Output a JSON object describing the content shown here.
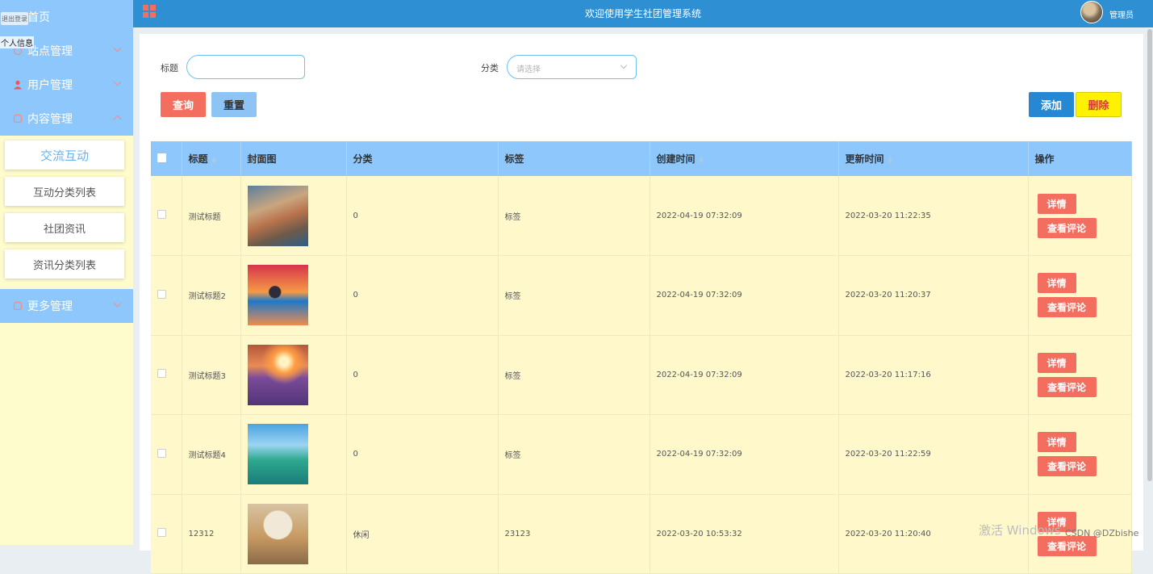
{
  "header": {
    "title": "欢迎使用学生社团管理系统",
    "user": "管理员",
    "colors": {
      "bar": "#2e8fd3",
      "grid_icon": "#f46e5f"
    }
  },
  "sidebar": {
    "logout_tag": "退出登录",
    "personal_tag": "个人信息",
    "menus": [
      {
        "label": "首页",
        "icon": "home-icon"
      },
      {
        "label": "站点管理",
        "icon": "site-icon"
      },
      {
        "label": "用户管理",
        "icon": "user-icon"
      },
      {
        "label": "内容管理",
        "icon": "content-icon"
      }
    ],
    "submenu": [
      {
        "label": "交流互动",
        "active": true
      },
      {
        "label": "互动分类列表"
      },
      {
        "label": "社团资讯"
      },
      {
        "label": "资讯分类列表"
      }
    ],
    "more": {
      "label": "更多管理",
      "icon": "more-icon"
    }
  },
  "filters": {
    "title_label": "标题",
    "title_value": "",
    "category_label": "分类",
    "category_placeholder": "请选择"
  },
  "buttons": {
    "search": "查询",
    "reset": "重置",
    "add": "添加",
    "delete": "删除"
  },
  "table": {
    "headers": {
      "title": "标题",
      "cover": "封面图",
      "category": "分类",
      "tag": "标签",
      "created": "创建时间",
      "updated": "更新时间",
      "actions": "操作"
    },
    "action_labels": {
      "detail": "详情",
      "comment": "查看评论"
    },
    "rows": [
      {
        "title": "测试标题",
        "category": "0",
        "tag": "标签",
        "created": "2022-04-19 07:32:09",
        "updated": "2022-03-20 11:22:35"
      },
      {
        "title": "测试标题2",
        "category": "0",
        "tag": "标签",
        "created": "2022-04-19 07:32:09",
        "updated": "2022-03-20 11:20:37"
      },
      {
        "title": "测试标题3",
        "category": "0",
        "tag": "标签",
        "created": "2022-04-19 07:32:09",
        "updated": "2022-03-20 11:17:16"
      },
      {
        "title": "测试标题4",
        "category": "0",
        "tag": "标签",
        "created": "2022-04-19 07:32:09",
        "updated": "2022-03-20 11:22:59"
      },
      {
        "title": "12312",
        "category": "休闲",
        "tag": "23123",
        "created": "2022-03-20 10:53:32",
        "updated": "2022-03-20 11:20:40"
      }
    ]
  },
  "watermark": {
    "windows": "激活 Windows",
    "csdn": "CSDN @DZbishe"
  }
}
